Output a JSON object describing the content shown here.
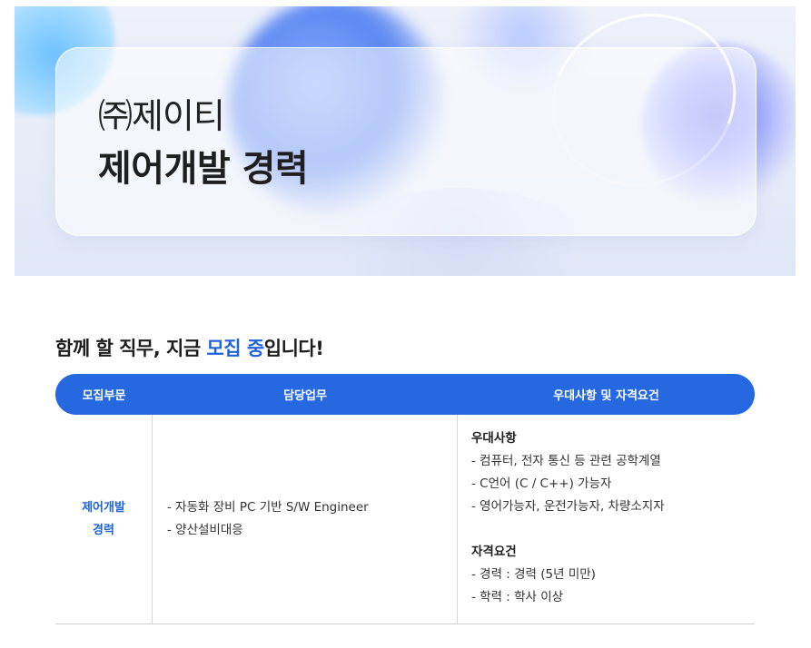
{
  "hero": {
    "company": "㈜제이티",
    "job_title": "제어개발 경력"
  },
  "headline": {
    "part1": "함께 할 직무, 지금 ",
    "highlight": "모집 중",
    "part2": "입니다!"
  },
  "table": {
    "headers": [
      "모집부문",
      "담당업무",
      "우대사항 및 자격요건"
    ],
    "row": {
      "division_line1": "제어개발",
      "division_line2": "경력",
      "duties": [
        "- 자동화 장비 PC 기반 S/W Engineer",
        "- 양산설비대응"
      ],
      "preferred_title": "우대사항",
      "preferred": [
        "- 컴퓨터, 전자 통신 등 관련 공학계열",
        "- C언어 (C / C++) 가능자",
        "- 영어가능자, 운전가능자, 차량소지자"
      ],
      "requirements_title": "자격요건",
      "requirements": [
        "- 경력 : 경력 (5년 미만)",
        "- 학력 : 학사 이상"
      ]
    }
  },
  "colors": {
    "accent": "#2568e0",
    "highlight_text": "#1f63d8"
  }
}
